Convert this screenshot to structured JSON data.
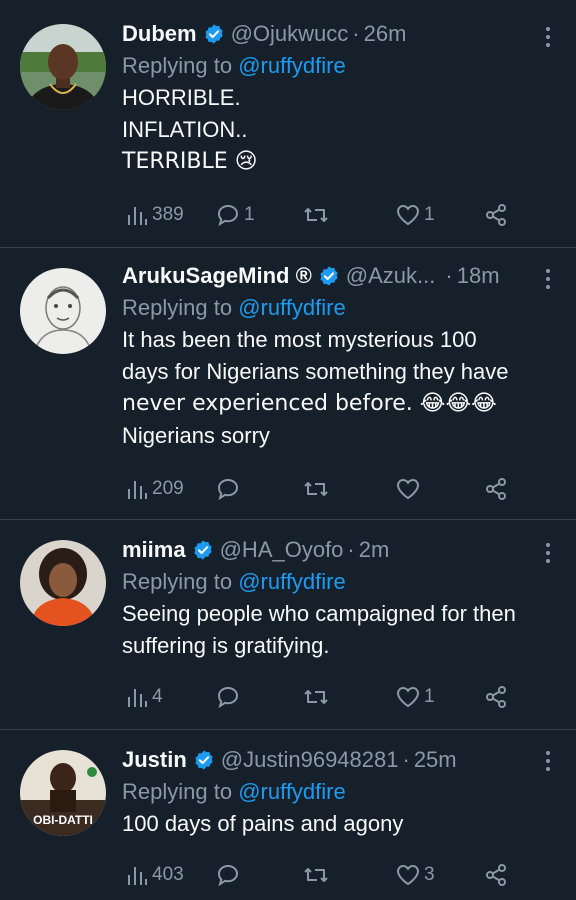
{
  "tweets": [
    {
      "name": "Dubem",
      "handle": "@Ojukwucc",
      "sep": "·",
      "time": "26m",
      "reply_prefix": "Replying to",
      "reply_to": "@ruffydfire",
      "lines": [
        "HORRIBLE.",
        "INFLATION..",
        "TERRIBLE 😢"
      ],
      "views": "389",
      "replies": "1",
      "retweets": "",
      "likes": "1"
    },
    {
      "name": "ArukuSageMind ®",
      "handle": "@Azuk...",
      "sep": "·",
      "time": "18m",
      "reply_prefix": "Replying to",
      "reply_to": "@ruffydfire",
      "lines": [
        "It has been the most mysterious 100",
        "days for Nigerians something they have",
        "never experienced before. 😂😂😂",
        "Nigerians sorry"
      ],
      "views": "209",
      "replies": "",
      "retweets": "",
      "likes": ""
    },
    {
      "name": "miima",
      "handle": "@HA_Oyofo",
      "sep": "·",
      "time": "2m",
      "reply_prefix": "Replying to",
      "reply_to": "@ruffydfire",
      "lines": [
        "Seeing people who campaigned for then",
        "suffering is gratifying."
      ],
      "views": "4",
      "replies": "",
      "retweets": "",
      "likes": "1"
    },
    {
      "name": "Justin",
      "handle": "@Justin96948281",
      "sep": "·",
      "time": "25m",
      "reply_prefix": "Replying to",
      "reply_to": "@ruffydfire",
      "lines": [
        "100 days of pains and agony"
      ],
      "views": "403",
      "replies": "",
      "retweets": "",
      "likes": "3",
      "avatar_text": "OBI-DATTI"
    }
  ],
  "colors": {
    "background": "#15202b",
    "text": "#f7f9f9",
    "muted": "#8b98a5",
    "accent": "#1d9bf0",
    "divider": "#38444d"
  },
  "icons": [
    "verified-badge-icon",
    "more-options-icon",
    "views-icon",
    "reply-icon",
    "retweet-icon",
    "like-icon",
    "share-icon"
  ]
}
